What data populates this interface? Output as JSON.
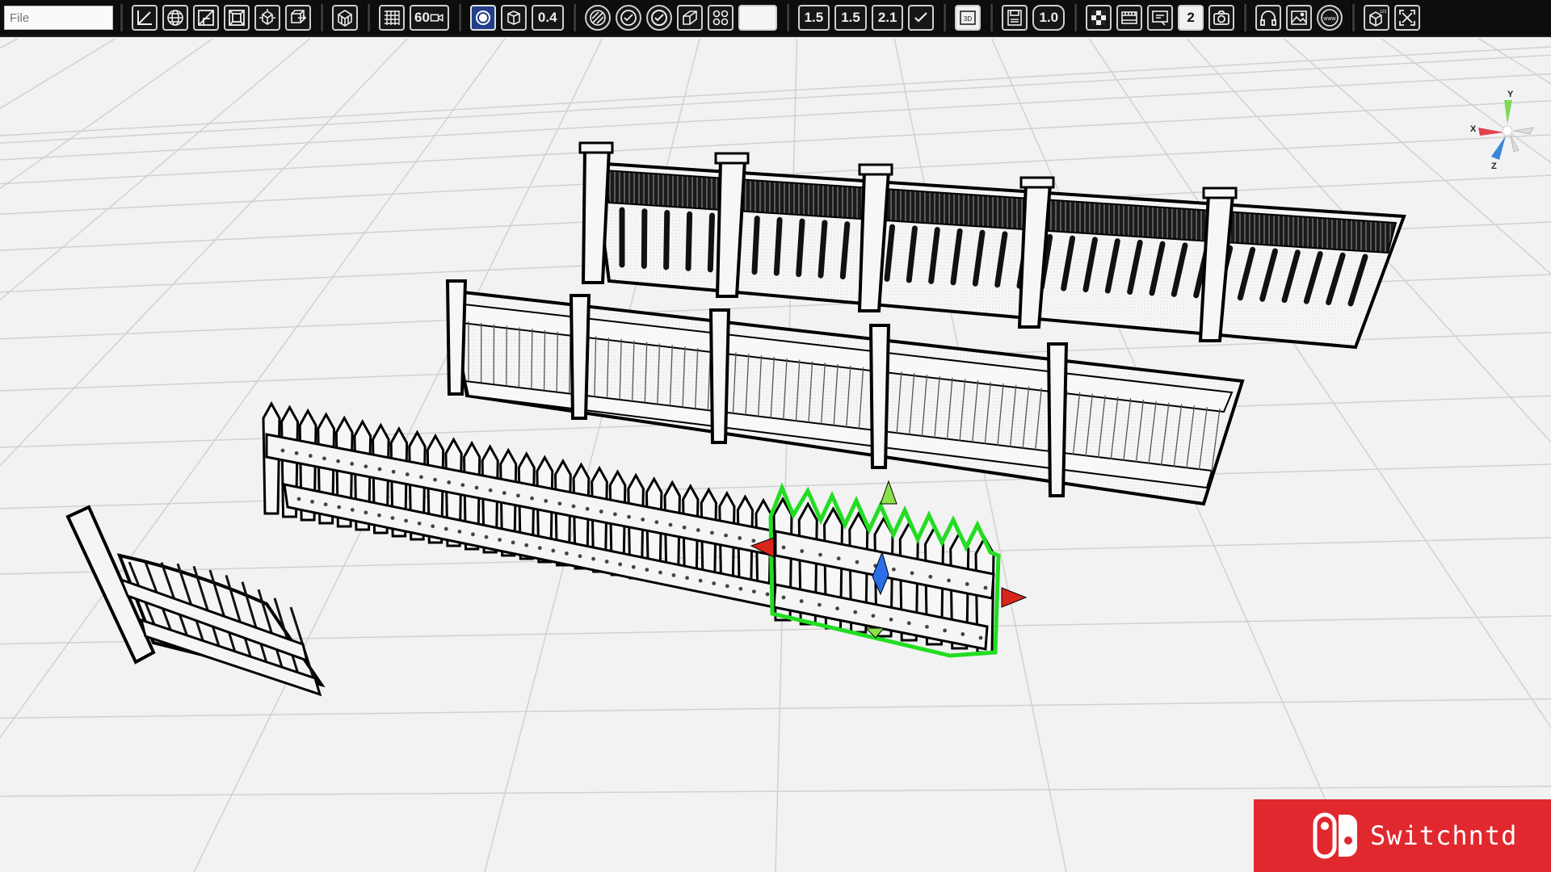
{
  "toolbar": {
    "file_placeholder": "File",
    "groups": [
      [
        "axis-icon",
        "wire-sphere-icon",
        "diagonal-box-icon",
        "frame-box-icon",
        "transform-cube-icon",
        "move-cube-icon"
      ],
      [
        "grid-cube-icon"
      ],
      [
        "grid-icon",
        "camera-fov"
      ],
      [
        "target-icon",
        "cube-icon",
        "value-0.4"
      ],
      [
        "stripe-circle-icon",
        "check-stripe-icon",
        "check-circle-icon",
        "box-shape-icon",
        "cluster-icon",
        "white-swatch"
      ],
      [
        "value-1.5a",
        "value-1.5b",
        "value-2.1",
        "checkbox-icon"
      ],
      [
        "view-3d-icon"
      ],
      [
        "floppy-icon",
        "value-1.0"
      ],
      [
        "checker-icon",
        "film-icon",
        "screen-icon",
        "layer-2-icon",
        "camera-icon"
      ],
      [
        "headphones-icon",
        "image-icon",
        "www-icon"
      ],
      [
        "numbered-cube-icon",
        "fit-view-icon"
      ]
    ],
    "fov_label": "60",
    "opacity_value": "0.4",
    "scale_values": [
      "1.5",
      "1.5",
      "2.1"
    ],
    "save_value": "1.0",
    "layer_number": "2",
    "cube_numbers": "123",
    "web_label": "www",
    "view_3d_label": "3D"
  },
  "gizmo": {
    "x_label": "X",
    "y_label": "Y",
    "z_label": "Z",
    "colors": {
      "x": "#e2424b",
      "y": "#7ed957",
      "z": "#3a86d9"
    }
  },
  "scene": {
    "selection_color": "#22dd22",
    "objects": [
      "vertical-slat-fence",
      "panel-railing-fence",
      "picket-fence",
      "picket-segment-selected",
      "gate"
    ]
  },
  "watermark": {
    "text": "Switchntd",
    "background": "#e0282e"
  }
}
